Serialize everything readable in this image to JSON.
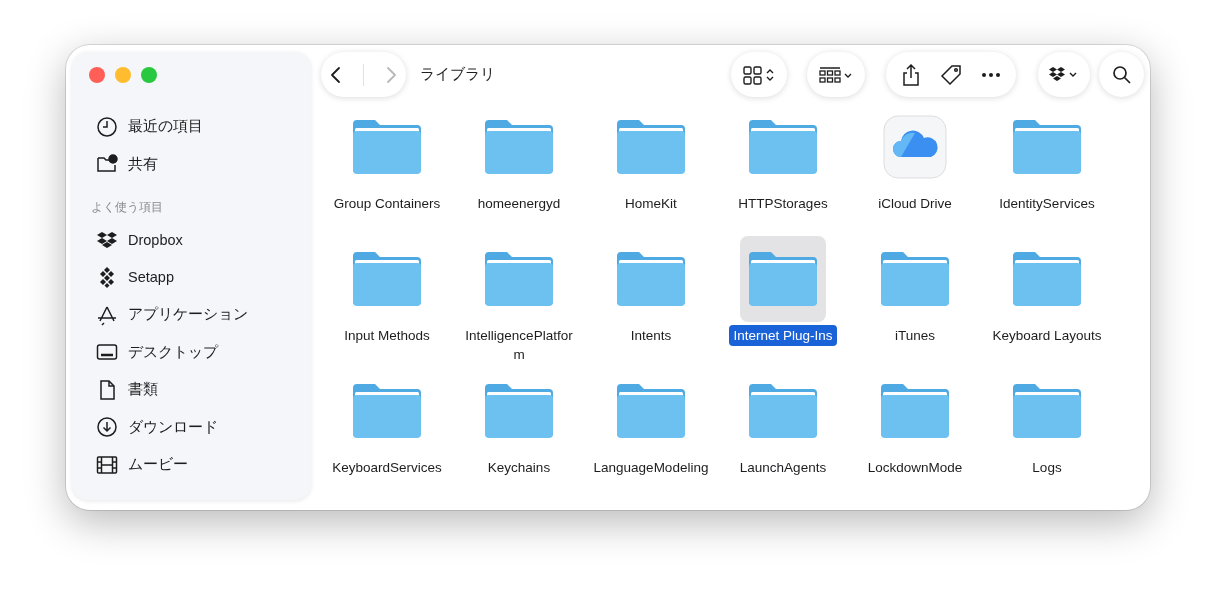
{
  "toolbar": {
    "title": "ライブラリ"
  },
  "sidebar": {
    "top_items": [
      {
        "label": "最近の項目"
      },
      {
        "label": "共有"
      }
    ],
    "favorites": {
      "heading": "よく使う項目",
      "items": [
        {
          "label": "Dropbox"
        },
        {
          "label": "Setapp"
        },
        {
          "label": "アプリケーション"
        },
        {
          "label": "デスクトップ"
        },
        {
          "label": "書類"
        },
        {
          "label": "ダウンロード"
        },
        {
          "label": "ムービー"
        }
      ]
    }
  },
  "files": [
    {
      "name": "Group Containers",
      "kind": "folder",
      "selected": false
    },
    {
      "name": "homeenergyd",
      "kind": "folder",
      "selected": false
    },
    {
      "name": "HomeKit",
      "kind": "folder",
      "selected": false
    },
    {
      "name": "HTTPStorages",
      "kind": "folder",
      "selected": false
    },
    {
      "name": "iCloud Drive",
      "kind": "icloud",
      "selected": false
    },
    {
      "name": "IdentityServices",
      "kind": "folder",
      "selected": false
    },
    {
      "name": "Input Methods",
      "kind": "folder",
      "selected": false
    },
    {
      "name": "IntelligencePlatform",
      "kind": "folder",
      "selected": false
    },
    {
      "name": "Intents",
      "kind": "folder",
      "selected": false
    },
    {
      "name": "Internet Plug-Ins",
      "kind": "folder",
      "selected": true
    },
    {
      "name": "iTunes",
      "kind": "folder",
      "selected": false
    },
    {
      "name": "Keyboard Layouts",
      "kind": "folder",
      "selected": false
    },
    {
      "name": "KeyboardServices",
      "kind": "folder",
      "selected": false
    },
    {
      "name": "Keychains",
      "kind": "folder",
      "selected": false
    },
    {
      "name": "LanguageModeling",
      "kind": "folder",
      "selected": false
    },
    {
      "name": "LaunchAgents",
      "kind": "folder",
      "selected": false
    },
    {
      "name": "LockdownMode",
      "kind": "folder",
      "selected": false
    },
    {
      "name": "Logs",
      "kind": "folder",
      "selected": false
    }
  ]
}
